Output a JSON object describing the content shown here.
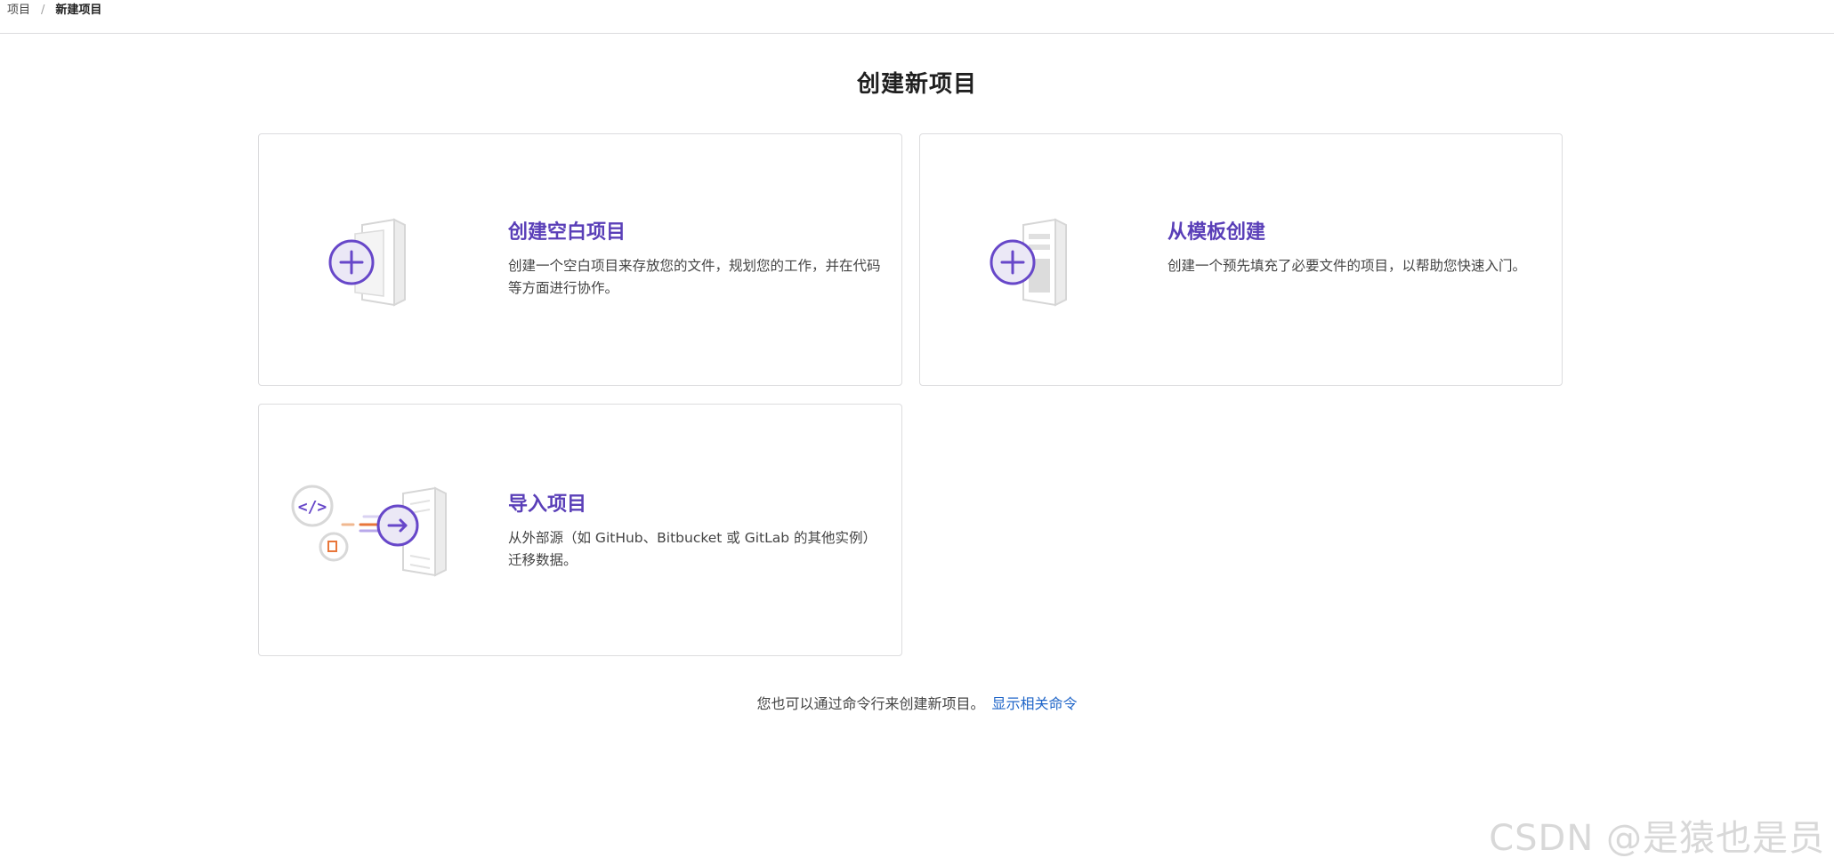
{
  "breadcrumb": {
    "parent": "项目",
    "separator": "/",
    "current": "新建项目"
  },
  "page": {
    "title": "创建新项目"
  },
  "cards": [
    {
      "title": "创建空白项目",
      "description": "创建一个空白项目来存放您的文件，规划您的工作，并在代码等方面进行协作。",
      "icon": "blank-project-icon"
    },
    {
      "title": "从模板创建",
      "description": "创建一个预先填充了必要文件的项目，以帮助您快速入门。",
      "icon": "template-project-icon"
    },
    {
      "title": "导入项目",
      "description": "从外部源（如 GitHub、Bitbucket 或 GitLab 的其他实例）迁移数据。",
      "icon": "import-project-icon"
    }
  ],
  "footer": {
    "note": "您也可以通过命令行来创建新项目。",
    "link": "显示相关命令"
  },
  "watermark": "CSDN @是猿也是员",
  "colors": {
    "accent": "#5a3fb8",
    "link": "#1f65c8",
    "border": "#dcdcde"
  }
}
